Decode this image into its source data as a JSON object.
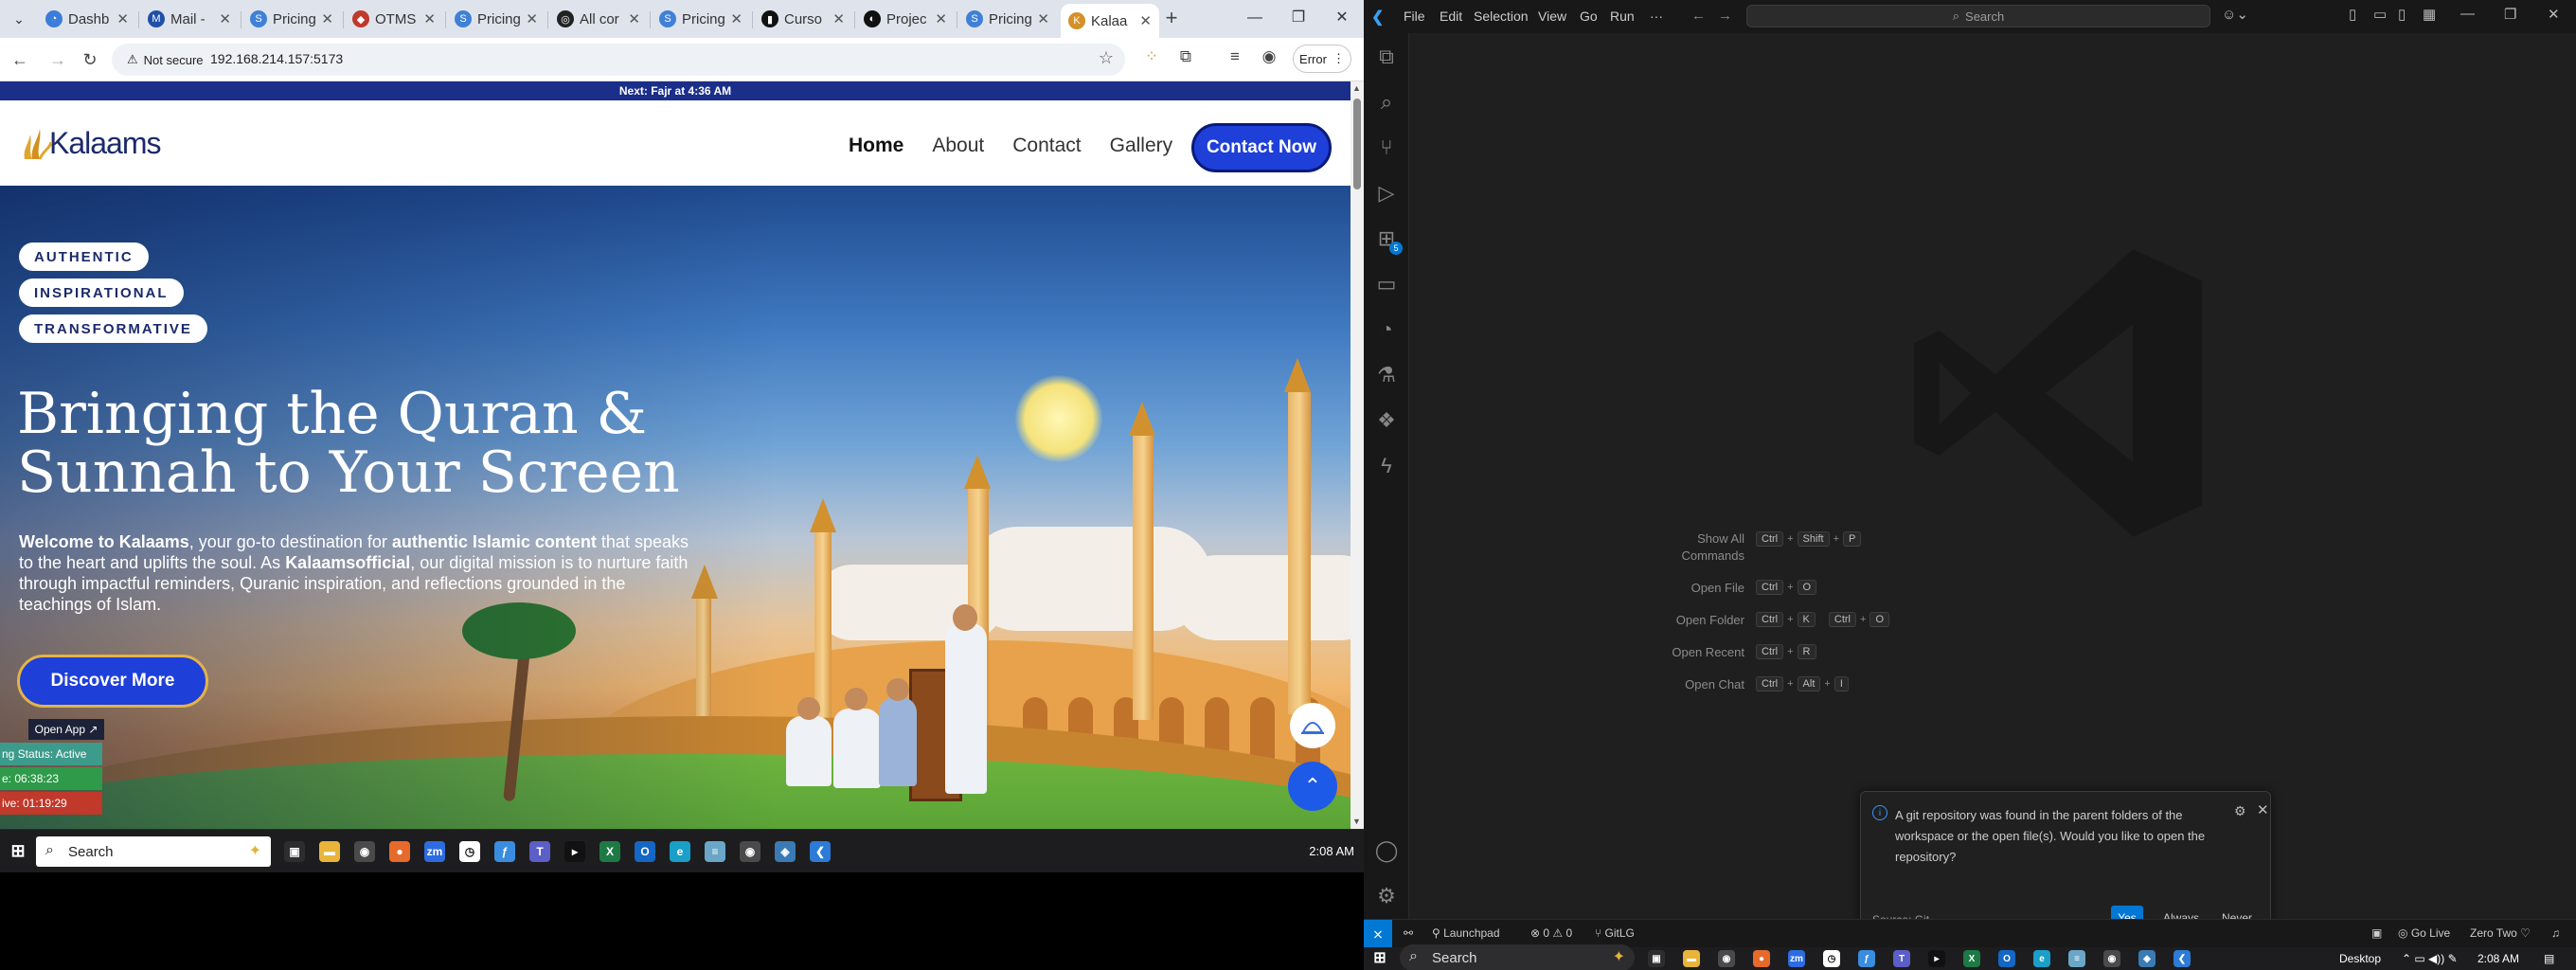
{
  "browser": {
    "tabs": [
      {
        "label": "Dashb",
        "color": "#3c7dd9",
        "glyph": "◔"
      },
      {
        "label": "Mail -",
        "color": "#1f4fa8",
        "glyph": "M"
      },
      {
        "label": "Pricing",
        "color": "#3f80d8",
        "glyph": "S"
      },
      {
        "label": "OTMS",
        "color": "#c0392b",
        "glyph": "◆"
      },
      {
        "label": "Pricing",
        "color": "#3f80d8",
        "glyph": "S"
      },
      {
        "label": "All cor",
        "color": "#222222",
        "glyph": "◎"
      },
      {
        "label": "Pricing",
        "color": "#3f80d8",
        "glyph": "S"
      },
      {
        "label": "Curso",
        "color": "#111111",
        "glyph": "▮"
      },
      {
        "label": "Projec",
        "color": "#111111",
        "glyph": "◐"
      },
      {
        "label": "Pricing",
        "color": "#3f80d8",
        "glyph": "S"
      },
      {
        "label": "Kalaa",
        "color": "#d4912a",
        "glyph": "K",
        "active": true
      }
    ],
    "not_secure": "Not secure",
    "url": "192.168.214.157:5173",
    "error_label": "Error"
  },
  "site": {
    "topbar": "Next: Fajr at 4:36 AM",
    "logo_text": "Kalaams",
    "nav": [
      "Home",
      "About",
      "Contact",
      "Gallery"
    ],
    "contact_button": "Contact Now",
    "pills": [
      "AUTHENTIC",
      "INSPIRATIONAL",
      "TRANSFORMATIVE"
    ],
    "hero_title": "Bringing the Quran & Sunnah to Your Screen",
    "hero_desc": {
      "p1_bold": "Welcome to Kalaams",
      "p2": ", your go-to destination for ",
      "p3_bold": "authentic Islamic content",
      "p4": " that speaks to the heart and uplifts the soul. As ",
      "p5_bold": "Kalaamsofficial",
      "p6": ", our digital mission is to nurture faith through impactful reminders, Quranic inspiration, and reflections grounded in the teachings of Islam."
    },
    "discover_button": "Discover More",
    "open_app": "Open App ↗",
    "status_lines": [
      {
        "text": "ng Status: Active",
        "color": "#3d9b8b"
      },
      {
        "text": "e: 06:38:23",
        "color": "#2e9a4a"
      },
      {
        "text": "ive: 01:19:29",
        "color": "#c0392b"
      }
    ]
  },
  "taskbar_left": {
    "search": "Search",
    "time": "2:08 AM",
    "icons": [
      {
        "name": "task-view-icon",
        "color": "#2d2d2f",
        "glyph": "▣"
      },
      {
        "name": "file-explorer-icon",
        "color": "#e8b53a",
        "glyph": "▬"
      },
      {
        "name": "chrome-icon",
        "color": "#4a4a4a",
        "glyph": "◉"
      },
      {
        "name": "firefox-icon",
        "color": "#e66a2c",
        "glyph": "●"
      },
      {
        "name": "zoom-icon",
        "color": "#2d6be0",
        "glyph": "zm"
      },
      {
        "name": "clock-icon",
        "color": "#ffffff",
        "glyph": "◷"
      },
      {
        "name": "pen-icon",
        "color": "#3a8dde",
        "glyph": "ƒ"
      },
      {
        "name": "teams-icon",
        "color": "#5b5fc7",
        "glyph": "T"
      },
      {
        "name": "terminal-icon",
        "color": "#111111",
        "glyph": "▸"
      },
      {
        "name": "excel-icon",
        "color": "#1d7a44",
        "glyph": "X"
      },
      {
        "name": "outlook-icon",
        "color": "#1467c4",
        "glyph": "O"
      },
      {
        "name": "edge-icon",
        "color": "#1aa0c8",
        "glyph": "e"
      },
      {
        "name": "notepad-icon",
        "color": "#6aa6c8",
        "glyph": "≡"
      },
      {
        "name": "chrome2-icon",
        "color": "#4a4a4a",
        "glyph": "◉"
      },
      {
        "name": "app-icon",
        "color": "#3a7ab5",
        "glyph": "◈"
      },
      {
        "name": "vscode-icon",
        "color": "#2c7bd6",
        "glyph": "❮"
      }
    ]
  },
  "vscode": {
    "menu": [
      "File",
      "Edit",
      "Selection",
      "View",
      "Go",
      "Run",
      "···"
    ],
    "command_center": "Search",
    "shortcuts": [
      {
        "label": "Show All Commands",
        "keys": [
          [
            "Ctrl",
            "Shift",
            "P"
          ]
        ]
      },
      {
        "label": "Open File",
        "keys": [
          [
            "Ctrl",
            "O"
          ]
        ]
      },
      {
        "label": "Open Folder",
        "keys": [
          [
            "Ctrl",
            "K"
          ],
          [
            "Ctrl",
            "O"
          ]
        ]
      },
      {
        "label": "Open Recent",
        "keys": [
          [
            "Ctrl",
            "R"
          ]
        ]
      },
      {
        "label": "Open Chat",
        "keys": [
          [
            "Ctrl",
            "Alt",
            "I"
          ]
        ]
      }
    ],
    "notification": {
      "message": "A git repository was found in the parent folders of the workspace or the open file(s). Would you like to open the repository?",
      "source": "Source: Git",
      "buttons": [
        "Yes",
        "Always",
        "Never"
      ]
    },
    "status": {
      "launchpad": "Launchpad",
      "problems": "⊗ 0 ⚠ 0",
      "gitlg": "GitLG",
      "golive": "Go Live",
      "profile": "Zero Two"
    },
    "extensions_badge": "5"
  },
  "taskbar_right": {
    "search": "Search",
    "desktop": "Desktop",
    "time": "2:08 AM"
  }
}
